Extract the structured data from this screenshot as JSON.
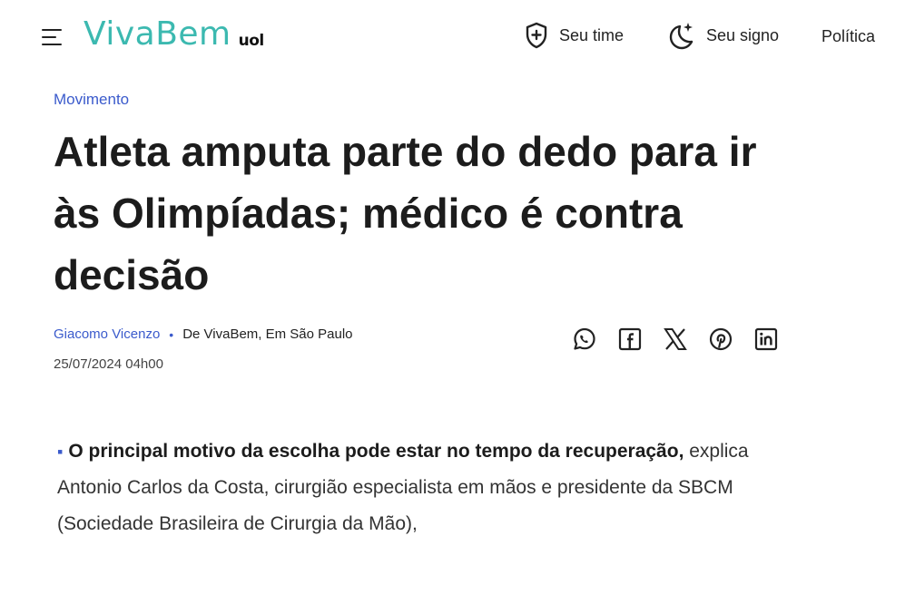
{
  "header": {
    "logo_main": "VivaBem",
    "logo_uol": "uol",
    "nav": [
      {
        "label": "Seu time",
        "icon": "shield-plus-icon"
      },
      {
        "label": "Seu signo",
        "icon": "moon-stars-icon"
      },
      {
        "label": "Política"
      }
    ]
  },
  "article": {
    "category": "Movimento",
    "title": "Atleta amputa parte do dedo para ir às Olimpíadas; médico é contra decisão",
    "author": "Giacomo Vicenzo",
    "source": "De VivaBem, Em São Paulo",
    "date": "25/07/2024 04h00",
    "lead_bold": "O principal motivo da escolha pode estar no tempo da recuperação,",
    "lead_rest": " explica Antonio Carlos da Costa, cirurgião especialista em mãos e presidente da SBCM (Sociedade Brasileira de Cirurgia da Mão),"
  },
  "share": [
    "whatsapp-icon",
    "facebook-icon",
    "x-icon",
    "pinterest-icon",
    "linkedin-icon"
  ],
  "colors": {
    "brand": "#3cb9b0",
    "link": "#3b5bcc",
    "text": "#1c1c1c"
  }
}
